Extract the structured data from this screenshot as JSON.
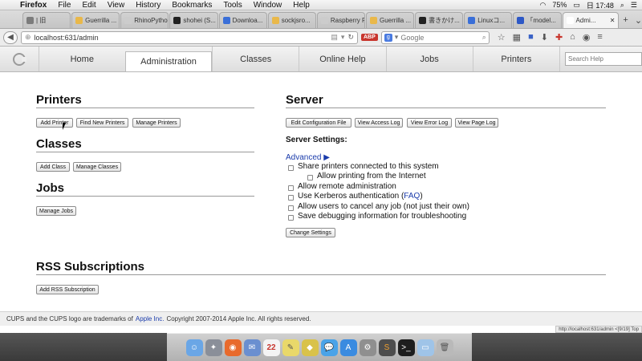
{
  "menubar": {
    "app": "Firefox",
    "items": [
      "File",
      "Edit",
      "View",
      "History",
      "Bookmarks",
      "Tools",
      "Window",
      "Help"
    ],
    "battery": "75%",
    "clock": "日 17:48"
  },
  "browser": {
    "tabs": [
      {
        "label": "| 旧",
        "color": "#7c7c7c"
      },
      {
        "label": "Guerrilla ...",
        "color": "#e9b84a"
      },
      {
        "label": "RhinoPython",
        "color": "#cccccc"
      },
      {
        "label": "shohei (S...",
        "color": "#222222"
      },
      {
        "label": "Downloa...",
        "color": "#3a6fd8"
      },
      {
        "label": "sockjsro...",
        "color": "#e9b84a"
      },
      {
        "label": "Raspberry Pi ...",
        "color": "#cccccc"
      },
      {
        "label": "Guerrilla ...",
        "color": "#e9b84a"
      },
      {
        "label": "書きかけ...",
        "color": "#222222"
      },
      {
        "label": "Linuxコ...",
        "color": "#3a6fd8"
      },
      {
        "label": "「model...",
        "color": "#2d58c6"
      },
      {
        "label": "Admi...",
        "color": "#ffffff"
      }
    ],
    "url": "localhost:631/admin",
    "search_placeholder": "Google"
  },
  "cups_nav": {
    "tabs": [
      "Home",
      "Administration",
      "Classes",
      "Online Help",
      "Jobs",
      "Printers"
    ],
    "search_placeholder": "Search Help"
  },
  "printers": {
    "title": "Printers",
    "buttons": [
      "Add Printer",
      "Find New Printers",
      "Manage Printers"
    ]
  },
  "classes": {
    "title": "Classes",
    "buttons": [
      "Add Class",
      "Manage Classes"
    ]
  },
  "jobs": {
    "title": "Jobs",
    "buttons": [
      "Manage Jobs"
    ]
  },
  "rss": {
    "title": "RSS Subscriptions",
    "buttons": [
      "Add RSS Subscription"
    ]
  },
  "server": {
    "title": "Server",
    "buttons": [
      "Edit Configuration File",
      "View Access Log",
      "View Error Log",
      "View Page Log"
    ],
    "settings_label": "Server Settings:",
    "advanced": "Advanced ▶",
    "options": [
      "Share printers connected to this system",
      "Allow printing from the Internet",
      "Allow remote administration",
      "Use Kerberos authentication (",
      "Allow users to cancel any job (not just their own)",
      "Save debugging information for troubleshooting"
    ],
    "faq_link": "FAQ",
    "faq_close": ")",
    "change_button": "Change Settings"
  },
  "footer": {
    "prefix": "CUPS and the CUPS logo are trademarks of",
    "link": "Apple Inc.",
    "suffix": "Copyright 2007-2014 Apple Inc. All rights reserved."
  },
  "statusbar": "http://localhost:631/admin <[9/19] Top"
}
